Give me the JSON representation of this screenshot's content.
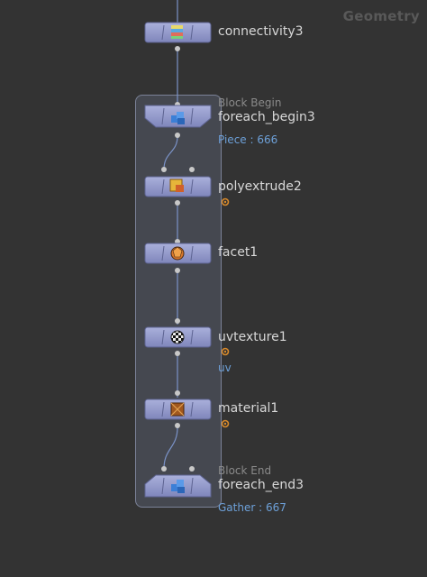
{
  "network": {
    "context_label": "Geometry"
  },
  "block": {
    "begin_label": "Block Begin",
    "end_label": "Block End"
  },
  "nodes": {
    "connectivity": {
      "name": "connectivity3",
      "icon": "connectivity-icon"
    },
    "foreach_begin": {
      "name": "foreach_begin3",
      "info": "Piece : 666",
      "icon": "blue-cubes-icon"
    },
    "polyextrude": {
      "name": "polyextrude2",
      "icon": "extrude-icon",
      "flag": "gear-icon"
    },
    "facet": {
      "name": "facet1",
      "icon": "facet-sphere-icon"
    },
    "uvtexture": {
      "name": "uvtexture1",
      "info": "uv",
      "icon": "checker-icon",
      "flag": "gear-icon"
    },
    "material": {
      "name": "material1",
      "icon": "material-crate-icon",
      "flag": "gear-icon"
    },
    "foreach_end": {
      "name": "foreach_end3",
      "info": "Gather : 667",
      "icon": "blue-cubes-icon"
    }
  },
  "colors": {
    "background": "#333333",
    "node_body": "#8b92c6",
    "wire": "#7b93c8",
    "info_text": "#6da0d8",
    "flag": "#d98a2b"
  }
}
